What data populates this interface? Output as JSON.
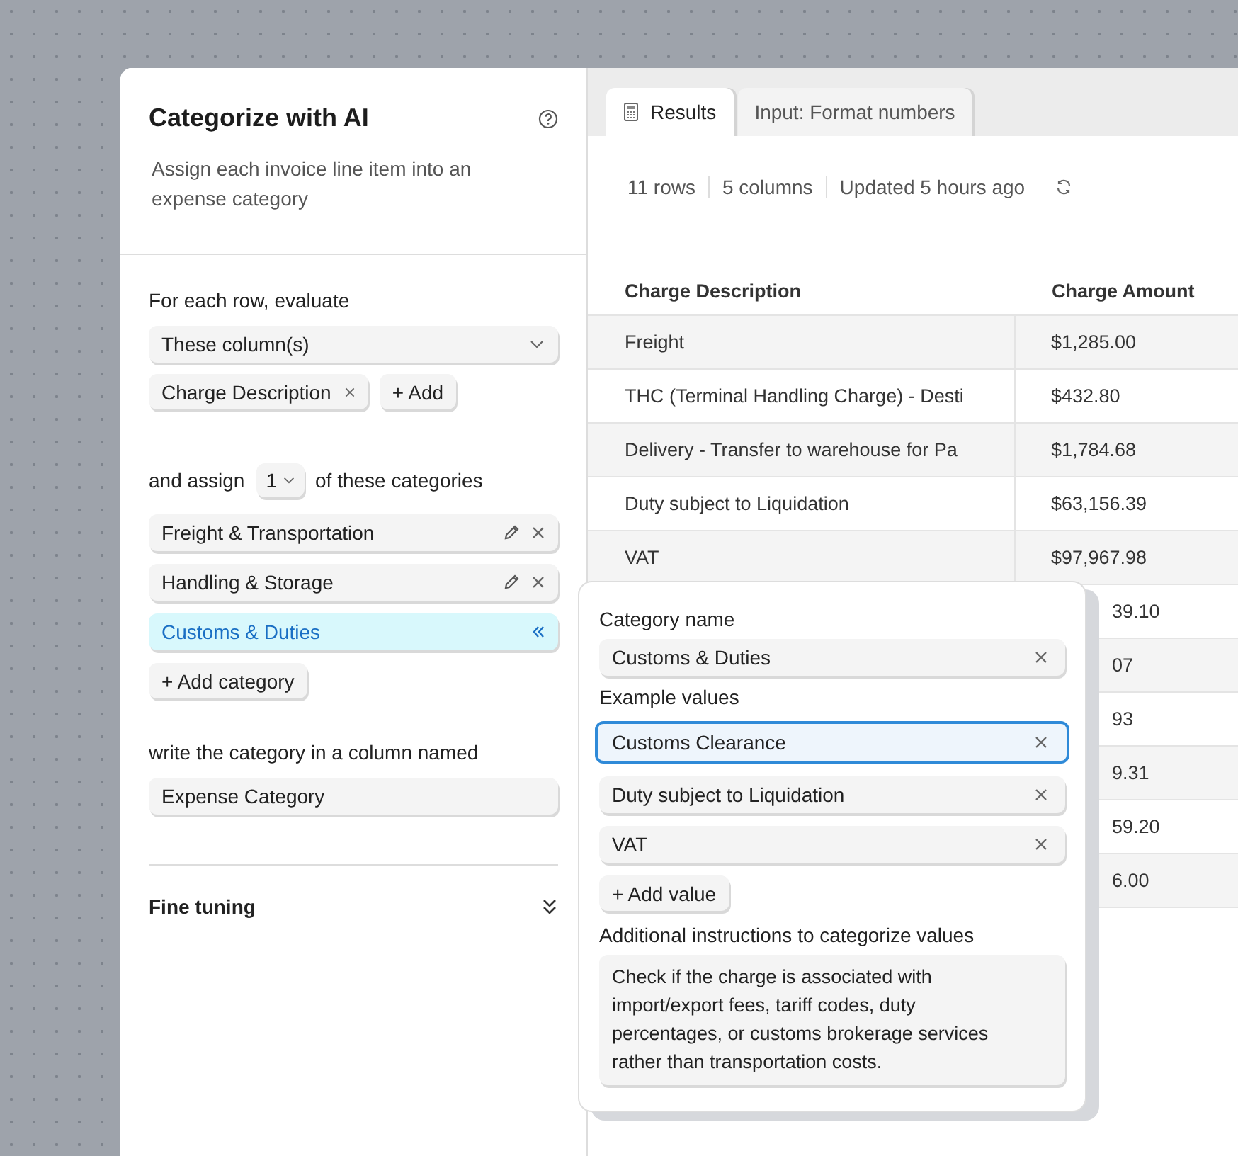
{
  "panel": {
    "title": "Categorize with AI",
    "description": "Assign each invoice line item into an expense category",
    "evaluate_label": "For each row, evaluate",
    "column_select": {
      "value": "These column(s)"
    },
    "columns": [
      {
        "label": "Charge Description"
      }
    ],
    "add_column_button": "+ Add",
    "assign_prefix": "and assign",
    "assign_count": "1",
    "assign_suffix": "of these categories",
    "categories": [
      {
        "name": "Freight & Transportation",
        "selected": false
      },
      {
        "name": "Handling & Storage",
        "selected": false
      },
      {
        "name": "Customs & Duties",
        "selected": true
      }
    ],
    "add_category_button": "+ Add category",
    "output_label": "write the category in a column named",
    "output_column": {
      "value": "Expense Category"
    },
    "fine_tuning": {
      "label": "Fine tuning",
      "expanded": false
    }
  },
  "tabs": [
    {
      "label": "Results",
      "selected": true
    },
    {
      "label": "Input: Format numbers",
      "selected": false
    }
  ],
  "stats": [
    "11 rows",
    "5 columns",
    "Updated 5 hours ago"
  ],
  "table": {
    "columns": [
      "Charge Description",
      "Charge Amount"
    ],
    "rows": [
      {
        "description": "Freight",
        "amount": "$1,285.00"
      },
      {
        "description": "THC (Terminal Handling Charge) - Desti",
        "amount": "$432.80"
      },
      {
        "description": "Delivery - Transfer to warehouse for Pa",
        "amount": "$1,784.68"
      },
      {
        "description": "Duty subject to Liquidation",
        "amount": "$63,156.39"
      },
      {
        "description": "VAT",
        "amount": "$97,967.98"
      },
      {
        "amount": "39.10"
      },
      {
        "amount": "07"
      },
      {
        "amount": "93"
      },
      {
        "amount": "9.31"
      },
      {
        "amount": "59.20"
      },
      {
        "amount": "6.00"
      }
    ]
  },
  "popover": {
    "name_label": "Category name",
    "name_value": "Customs & Duties",
    "examples_label": "Example values",
    "examples": [
      {
        "value": "Customs Clearance",
        "focused": true
      },
      {
        "value": "Duty subject to Liquidation",
        "focused": false
      },
      {
        "value": "VAT",
        "focused": false
      }
    ],
    "add_value_button": "+ Add value",
    "instructions_label": "Additional instructions to categorize values",
    "instructions": "Check if the charge is associated with import/export fees, tariff codes, duty percentages, or customs brokerage services rather than transportation costs."
  }
}
